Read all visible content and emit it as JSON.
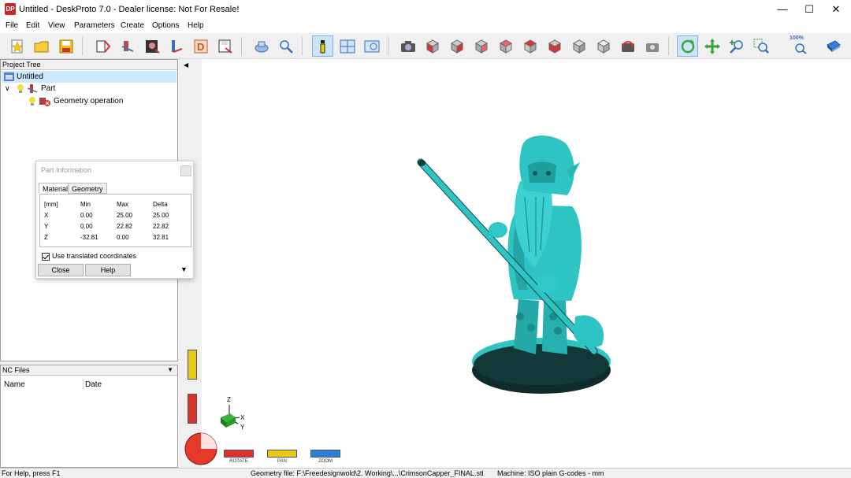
{
  "window": {
    "title": "Untitled - DeskProto 7.0 - Dealer license: Not For Resale!",
    "app_icon": "DP",
    "controls": [
      "minimize-icon",
      "maximize-icon",
      "close-icon"
    ]
  },
  "menu": [
    "File",
    "Edit",
    "View",
    "Parameters",
    "Create",
    "Options",
    "Help"
  ],
  "toolbar": {
    "zoom_label": "100%",
    "icons": [
      "new-project-icon",
      "open-project-icon",
      "save-icon",
      "wizard-icon",
      "part-wizard-icon",
      "image-wizard-icon",
      "vector-wizard-icon",
      "d-icon",
      "save-nc-icon",
      "cad-icon",
      "search-icon",
      "info-icon",
      "layout-icon",
      "preview-icon",
      "screenshot-icon",
      "view-front-icon",
      "view-back-icon",
      "view-left-icon",
      "view-right-icon",
      "view-top-icon",
      "view-bottom-icon",
      "view-iso-icon",
      "view-iso-2-icon",
      "rotate-view-icon",
      "reset-view-icon",
      "rotate-mode-icon",
      "pan-mode-icon",
      "zoom-in-icon",
      "zoom-window-icon",
      "zoom-100-icon",
      "book-icon"
    ]
  },
  "project_tree": {
    "header": "Project Tree",
    "items": [
      {
        "label": "Untitled",
        "level": 0
      },
      {
        "label": "Part",
        "level": 1
      },
      {
        "label": "Geometry operation",
        "level": 2
      }
    ]
  },
  "nc_files": {
    "header": "NC Files",
    "columns": [
      "Name",
      "Date"
    ]
  },
  "part_info": {
    "title": "Part Information",
    "tabs": [
      "Material",
      "Geometry"
    ],
    "headers": [
      "[mm]",
      "Min",
      "Max",
      "Delta"
    ],
    "rows": [
      [
        "X",
        "0.00",
        "25.00",
        "25.00"
      ],
      [
        "Y",
        "0.00",
        "22.82",
        "22.82"
      ],
      [
        "Z",
        "-32.81",
        "0.00",
        "32.81"
      ]
    ],
    "checkbox_label": "Use translated coordinates",
    "close_label": "Close",
    "help_label": "Help"
  },
  "view_modes": [
    {
      "label": "ROTATE",
      "color": "#d9342b"
    },
    {
      "label": "PAN",
      "color": "#e8c81a"
    },
    {
      "label": "ZOOM",
      "color": "#2b7fd9"
    }
  ],
  "axes": {
    "z": "Z",
    "x": "X",
    "y": "Y"
  },
  "model_color": "#2ec4c4",
  "status": {
    "help": "For Help, press F1",
    "geometry_file": "Geometry file: F:\\Freedesignwold\\2. Working\\...\\CrimsonCapper_FINAL.stl",
    "machine": "Machine: ISO plain G-codes - mm"
  }
}
